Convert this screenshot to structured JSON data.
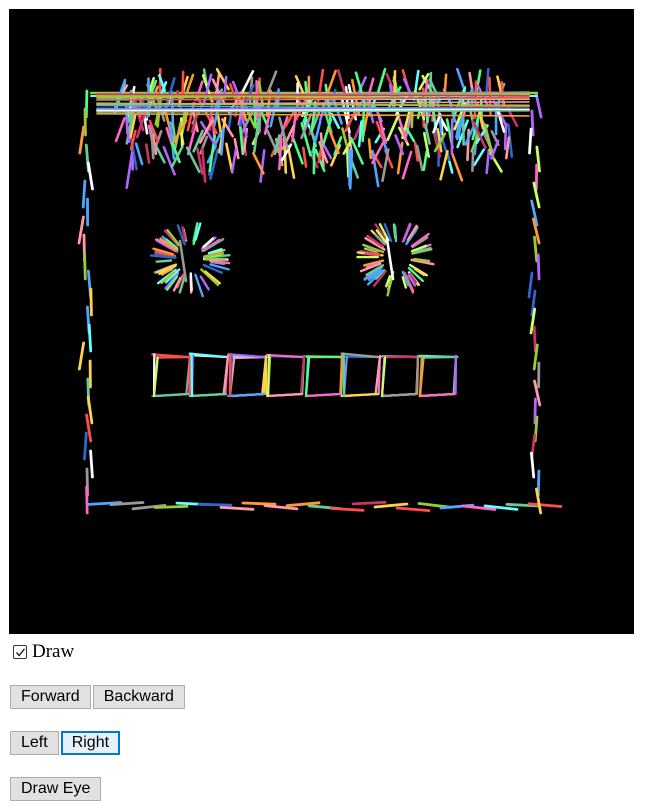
{
  "controls": {
    "draw_checkbox": {
      "label": "Draw",
      "checked": true
    },
    "forward_label": "Forward",
    "backward_label": "Backward",
    "left_label": "Left",
    "right_label": "Right",
    "draw_eye_label": "Draw Eye"
  },
  "canvas": {
    "background": "#000000",
    "palette": [
      "#ff4d4d",
      "#4dff88",
      "#4da6ff",
      "#ffd24d",
      "#ff66cc",
      "#66ffff",
      "#b366ff",
      "#ffffff",
      "#99cc33",
      "#ff9933",
      "#3366cc",
      "#cc3366",
      "#66cc99",
      "#999999",
      "#ccff66",
      "#ff99aa"
    ]
  },
  "icons": {
    "checkmark": "checkmark-icon"
  }
}
